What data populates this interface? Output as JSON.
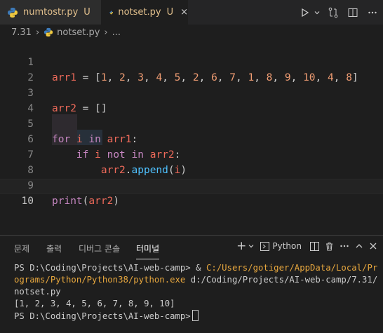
{
  "tabs": [
    {
      "name": "numtostr.py",
      "status": "U",
      "active": false
    },
    {
      "name": "notset.py",
      "status": "U",
      "active": true,
      "close": "×"
    }
  ],
  "breadcrumb": {
    "folder": "7.31",
    "file": "notset.py",
    "more": "..."
  },
  "editor": {
    "line_numbers": [
      "1",
      "2",
      "3",
      "4",
      "5",
      "6",
      "7",
      "8",
      "9",
      "10"
    ],
    "current_line": "10"
  },
  "panel": {
    "tabs": [
      "문제",
      "출력",
      "디버그 콘솔",
      "터미널"
    ],
    "active_tab": "터미널",
    "shell": "Python"
  },
  "terminal": {
    "line1_prompt": "PS D:\\Coding\\Projects\\AI-web-camp> & ",
    "line1_exe": "C:/Users/gotiger/AppData/Local/Programs/Python/Python38/python.exe",
    "line1_arg": " d:/Coding/Projects/AI-web-camp/7.31/notset.py",
    "output": "[1, 2, 3, 4, 5, 6, 7, 8, 9, 10]",
    "prompt2": "PS D:\\Coding\\Projects\\AI-web-camp>"
  },
  "colors": {
    "accent": "#e2c08d",
    "background": "#1e1e1e",
    "keyword": "#c586c0",
    "number": "#f29e74"
  }
}
